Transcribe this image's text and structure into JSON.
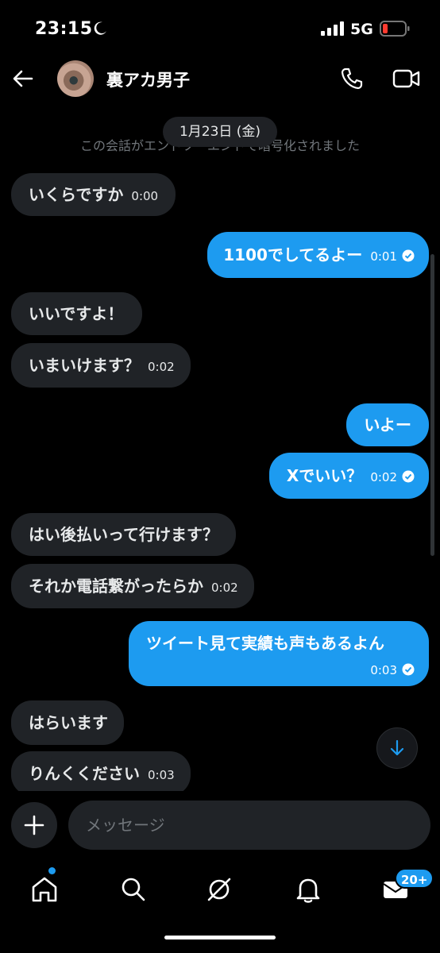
{
  "status_bar": {
    "time": "23:15",
    "network": "5G"
  },
  "header": {
    "contact_name": "裏アカ男子"
  },
  "conversation": {
    "date": "1月23日 (金)",
    "encryption_note": "この会話がエンドツーエンドで暗号化されました",
    "messages": [
      {
        "dir": "in",
        "text": "いくらですか",
        "time": "0:00"
      },
      {
        "dir": "out",
        "text": "1100でしてるよー",
        "time": "0:01"
      },
      {
        "dir": "in",
        "text": "いいですよ！",
        "time": ""
      },
      {
        "dir": "in",
        "text": "いまいけます？",
        "time": "0:02"
      },
      {
        "dir": "out",
        "text": "いよー",
        "time": ""
      },
      {
        "dir": "out",
        "text": "Xでいい？",
        "time": "0:02"
      },
      {
        "dir": "in",
        "text": "はい後払いって行けます？",
        "time": ""
      },
      {
        "dir": "in",
        "text": "それか電話繋がったらか",
        "time": "0:02"
      },
      {
        "dir": "out",
        "text": "ツイート見て実績も声もあるよん",
        "time": "0:03"
      },
      {
        "dir": "in",
        "text": "はらいます",
        "time": ""
      },
      {
        "dir": "in",
        "text": "りんくください",
        "time": "0:03"
      }
    ]
  },
  "composer": {
    "placeholder": "メッセージ"
  },
  "nav": {
    "messages_badge": "20+"
  },
  "colors": {
    "accent": "#1d9bf0",
    "incoming_bubble": "#202327",
    "background": "#000000"
  }
}
